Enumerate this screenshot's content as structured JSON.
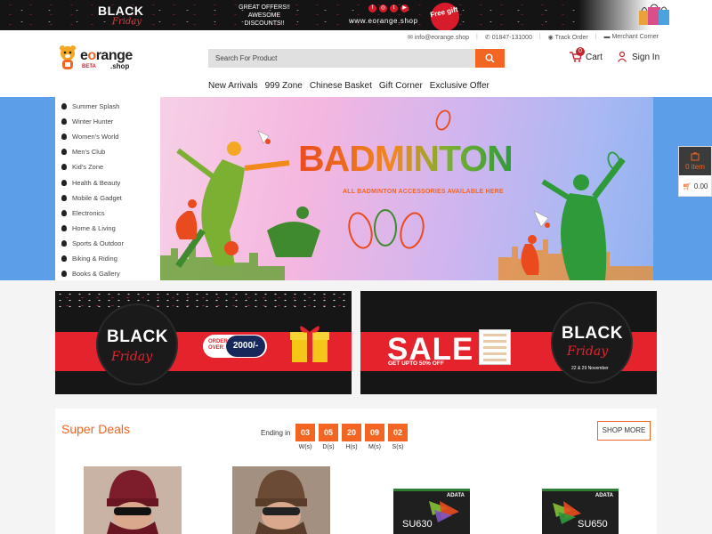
{
  "promo": {
    "black": "BLACK",
    "friday": "Friday",
    "offer": "GREAT OFFERS!! AWESOME DISCOUNTS!!",
    "site": "www.eorange.shop",
    "free_gift": "Free gift"
  },
  "toplinks": {
    "email": "info@eorange.shop",
    "phone": "01847-131000",
    "track": "Track Order",
    "merchant": "Merchant Corner"
  },
  "logo": {
    "name_pre": "e",
    "name_o": "o",
    "name_post": "range",
    "beta": "BETA",
    "shop": ".shop"
  },
  "search": {
    "placeholder": "Search For Product"
  },
  "cart": {
    "label": "Cart",
    "count": "0"
  },
  "signin": {
    "label": "Sign In"
  },
  "nav": [
    "New Arrivals",
    "999 Zone",
    "Chinese Basket",
    "Gift Corner",
    "Exclusive Offer"
  ],
  "categories": [
    "Summer Splash",
    "Winter Hunter",
    "Women's World",
    "Men's Club",
    "Kid's Zone",
    "Health & Beauty",
    "Mobile & Gadget",
    "Electronics",
    "Home & Living",
    "Sports & Outdoor",
    "Biking & Riding",
    "Books & Gallery"
  ],
  "hero": {
    "title": "BADMINTON",
    "tagline": "ALL BADMINTON ACCESSORIES AVAILABLE HERE"
  },
  "mini_cart": {
    "items": "0 item",
    "total": "0.00"
  },
  "bf_left": {
    "black": "BLACK",
    "friday": "Friday",
    "order_over_1": "ORDER",
    "order_over_2": "OVER",
    "amount": "2000/-"
  },
  "bf_right": {
    "sale": "SALE",
    "sale_sub": "GET UPTO 50% OFF",
    "black": "BLACK",
    "friday": "Friday",
    "dates": "22 & 29 November"
  },
  "deals": {
    "title": "Super Deals",
    "ending": "Ending in",
    "countdown": [
      {
        "value": "03",
        "unit": "W(s)"
      },
      {
        "value": "05",
        "unit": "D(s)"
      },
      {
        "value": "20",
        "unit": "H(s)"
      },
      {
        "value": "09",
        "unit": "M(s)"
      },
      {
        "value": "02",
        "unit": "S(s)"
      }
    ],
    "shop_more": "SHOP MORE",
    "ssd": [
      {
        "brand": "ADATA",
        "model": "SU630"
      },
      {
        "brand": "ADATA",
        "model": "SU650"
      }
    ]
  },
  "colors": {
    "accent": "#f26522",
    "brand_red": "#c0272d",
    "hero_bg": "#5d9ee8",
    "navy": "#16285a"
  }
}
